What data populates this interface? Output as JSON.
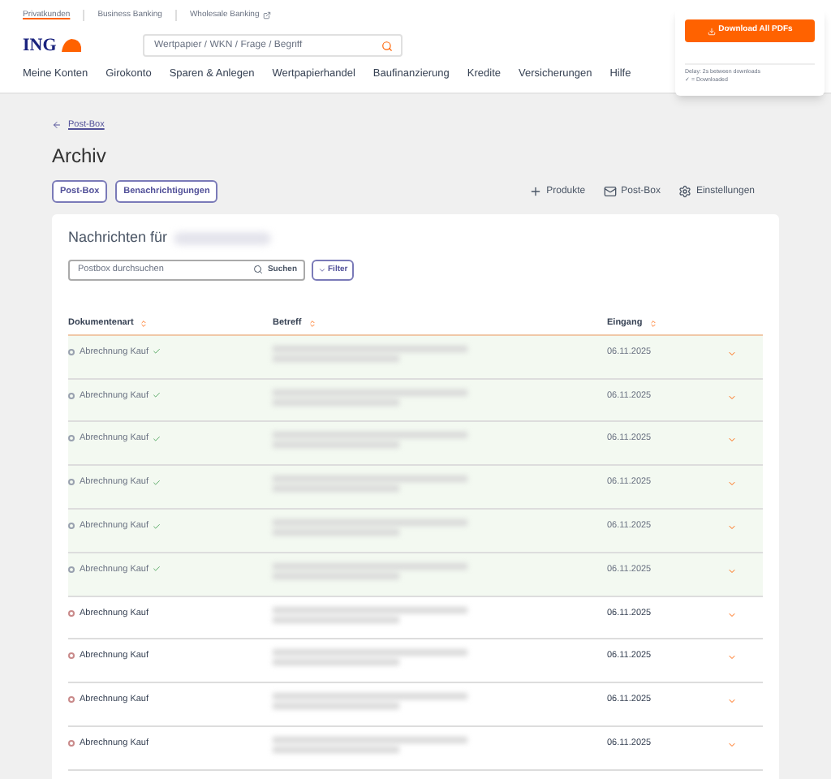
{
  "top_links": [
    {
      "label": "Privatkunden",
      "selected": true,
      "external": false
    },
    {
      "label": "Business Banking",
      "selected": false,
      "external": false
    },
    {
      "label": "Wholesale Banking",
      "selected": false,
      "external": true
    }
  ],
  "logo": "ING",
  "search": {
    "placeholder": "Wertpapier / WKN / Frage / Begriff"
  },
  "nav": [
    "Meine Konten",
    "Girokonto",
    "Sparen & Anlegen",
    "Wertpapierhandel",
    "Baufinanzierung",
    "Kredite",
    "Versicherungen",
    "Hilfe"
  ],
  "download_popup": {
    "button": "Download All PDFs",
    "notes": [
      "Delay: 2s between downloads",
      "✓ = Downloaded"
    ]
  },
  "breadcrumb": "Post-Box",
  "title": "Archiv",
  "buttons": [
    "Post-Box",
    "Benachrichtigungen"
  ],
  "actions": [
    {
      "kind": "plus",
      "label": "Produkte"
    },
    {
      "kind": "mail",
      "label": "Post-Box"
    },
    {
      "kind": "gear",
      "label": "Einstellungen"
    }
  ],
  "card": {
    "title": "Nachrichten für",
    "search_placeholder": "Postbox durchsuchen",
    "search_button": "Suchen",
    "filter_button": "Filter",
    "columns": [
      "Dokumentenart",
      "Betreff",
      "Eingang"
    ],
    "rows": [
      {
        "doc_type": "Abrechnung Kauf",
        "date": "06.11.2025",
        "downloaded": true
      },
      {
        "doc_type": "Abrechnung Kauf",
        "date": "06.11.2025",
        "downloaded": true
      },
      {
        "doc_type": "Abrechnung Kauf",
        "date": "06.11.2025",
        "downloaded": true
      },
      {
        "doc_type": "Abrechnung Kauf",
        "date": "06.11.2025",
        "downloaded": true
      },
      {
        "doc_type": "Abrechnung Kauf",
        "date": "06.11.2025",
        "downloaded": true
      },
      {
        "doc_type": "Abrechnung Kauf",
        "date": "06.11.2025",
        "downloaded": true
      },
      {
        "doc_type": "Abrechnung Kauf",
        "date": "06.11.2025",
        "downloaded": false
      },
      {
        "doc_type": "Abrechnung Kauf",
        "date": "06.11.2025",
        "downloaded": false
      },
      {
        "doc_type": "Abrechnung Kauf",
        "date": "06.11.2025",
        "downloaded": false
      },
      {
        "doc_type": "Abrechnung Kauf",
        "date": "06.11.2025",
        "downloaded": false
      }
    ]
  }
}
